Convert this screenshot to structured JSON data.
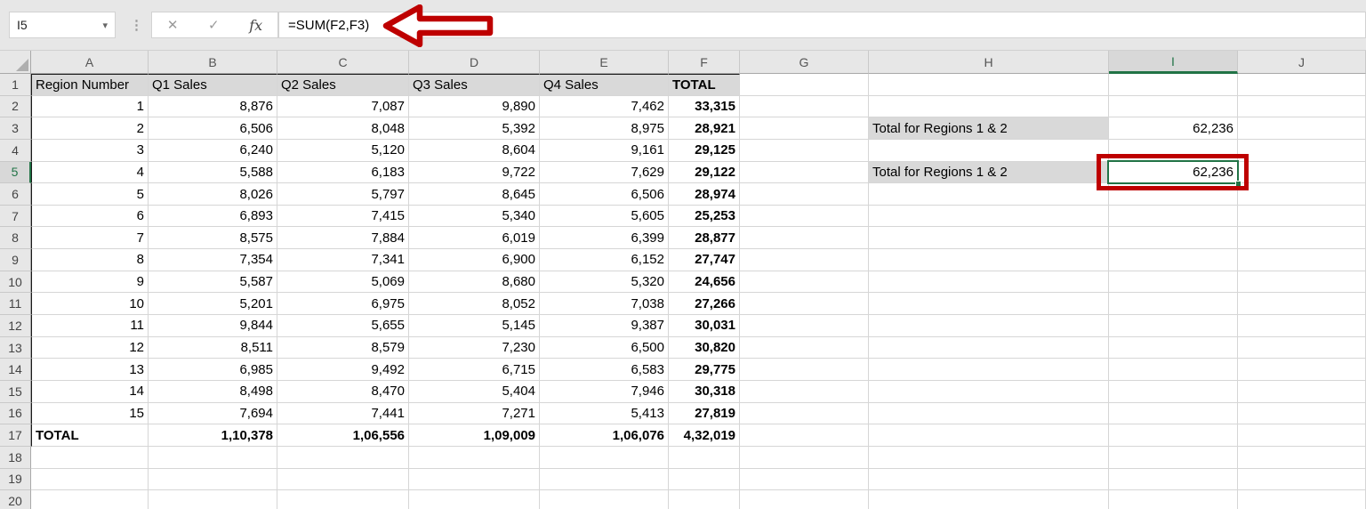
{
  "formula_bar": {
    "name_box_value": "I5",
    "formula": "=SUM(F2,F3)"
  },
  "icons": {
    "name_box_dropdown": "▾",
    "separator_dots": "⋮",
    "cancel": "✕",
    "enter": "✓",
    "function": "fx"
  },
  "sheet": {
    "column_headers": [
      "A",
      "B",
      "C",
      "D",
      "E",
      "F",
      "G",
      "H",
      "I",
      "J"
    ],
    "visible_rows": 20,
    "selected_cell": "I5",
    "selected_column": "I",
    "selected_row": 5
  },
  "table": {
    "range": "A1:F17",
    "headers": [
      "Region Number",
      "Q1 Sales",
      "Q2 Sales",
      "Q3 Sales",
      "Q4 Sales",
      "TOTAL"
    ],
    "rows": [
      [
        "1",
        "8,876",
        "7,087",
        "9,890",
        "7,462",
        "33,315"
      ],
      [
        "2",
        "6,506",
        "8,048",
        "5,392",
        "8,975",
        "28,921"
      ],
      [
        "3",
        "6,240",
        "5,120",
        "8,604",
        "9,161",
        "29,125"
      ],
      [
        "4",
        "5,588",
        "6,183",
        "9,722",
        "7,629",
        "29,122"
      ],
      [
        "5",
        "8,026",
        "5,797",
        "8,645",
        "6,506",
        "28,974"
      ],
      [
        "6",
        "6,893",
        "7,415",
        "5,340",
        "5,605",
        "25,253"
      ],
      [
        "7",
        "8,575",
        "7,884",
        "6,019",
        "6,399",
        "28,877"
      ],
      [
        "8",
        "7,354",
        "7,341",
        "6,900",
        "6,152",
        "27,747"
      ],
      [
        "9",
        "5,587",
        "5,069",
        "8,680",
        "5,320",
        "24,656"
      ],
      [
        "10",
        "5,201",
        "6,975",
        "8,052",
        "7,038",
        "27,266"
      ],
      [
        "11",
        "9,844",
        "5,655",
        "5,145",
        "9,387",
        "30,031"
      ],
      [
        "12",
        "8,511",
        "8,579",
        "7,230",
        "6,500",
        "30,820"
      ],
      [
        "13",
        "6,985",
        "9,492",
        "6,715",
        "6,583",
        "29,775"
      ],
      [
        "14",
        "8,498",
        "8,470",
        "5,404",
        "7,946",
        "30,318"
      ],
      [
        "15",
        "7,694",
        "7,441",
        "7,271",
        "5,413",
        "27,819"
      ]
    ],
    "total_row": [
      "TOTAL",
      "1,10,378",
      "1,06,556",
      "1,09,009",
      "1,06,076",
      "4,32,019"
    ]
  },
  "summary": {
    "items": [
      {
        "row": 3,
        "label": "Total for Regions 1 & 2",
        "value": "62,236"
      },
      {
        "row": 5,
        "label": "Total for Regions 1 & 2",
        "value": "62,236"
      }
    ]
  },
  "annotations": {
    "arrow_points_to": "formula-bar",
    "red_box_around": "I5"
  },
  "colors": {
    "selection_green": "#217346",
    "annotation_red": "#BE0000",
    "table_header_fill": "#D9D9D9",
    "chrome_gray": "#E7E7E7"
  }
}
